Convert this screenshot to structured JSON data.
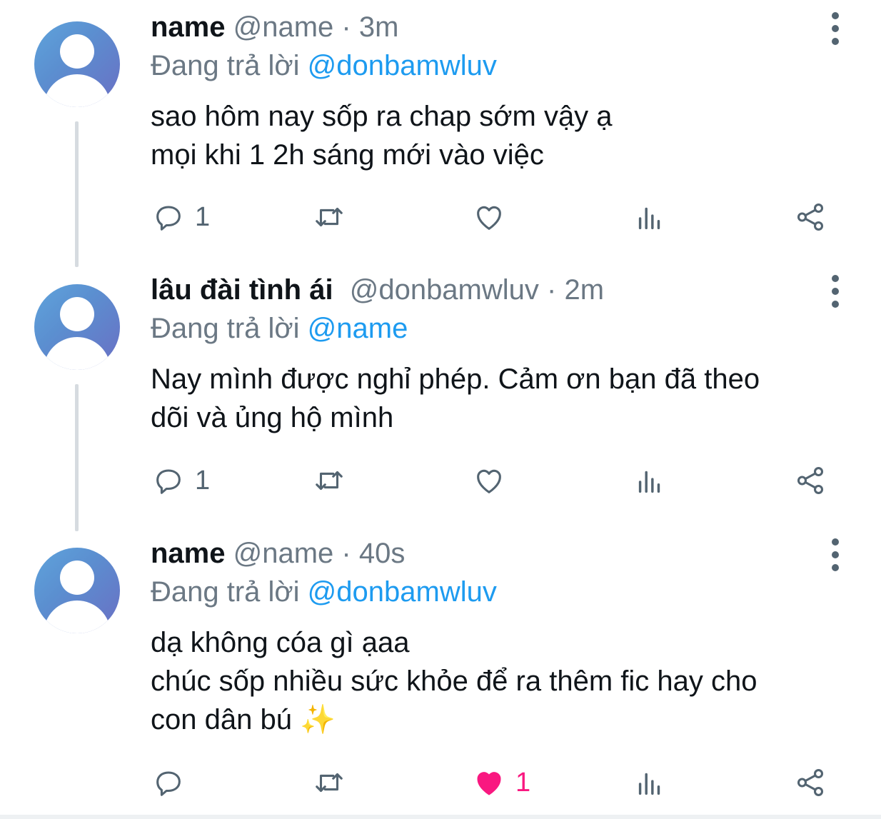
{
  "colors": {
    "link": "#1d9bf0",
    "muted": "#6b7884",
    "text": "#0f1419",
    "like_active": "#f91880"
  },
  "tweets": [
    {
      "display_name": "name",
      "handle": "@name",
      "separator": "·",
      "time": "3m",
      "reply_prefix": "Đang trả lời",
      "reply_to": "@donbamwluv",
      "text": "sao hôm nay sốp ra chap sớm vậy ạ\nmọi khi 1 2h sáng mới vào việc",
      "reply_count": "1",
      "like_count": "",
      "liked": false
    },
    {
      "display_name": "lâu đài tình ái",
      "handle": "@donbamwluv",
      "separator": "·",
      "time": "2m",
      "reply_prefix": "Đang trả lời",
      "reply_to": "@name",
      "text": "Nay mình được nghỉ phép. Cảm ơn bạn đã theo\ndõi và ủng hộ mình",
      "reply_count": "1",
      "like_count": "",
      "liked": false
    },
    {
      "display_name": "name",
      "handle": "@name",
      "separator": "·",
      "time": "40s",
      "reply_prefix": "Đang trả lời",
      "reply_to": "@donbamwluv",
      "text": "dạ không cóa gì ạaa\nchúc sốp nhiều sức khỏe để ra thêm fic hay cho\ncon dân bú ✨",
      "reply_count": "",
      "like_count": "1",
      "liked": true
    }
  ],
  "icons": {
    "reply": "reply-icon",
    "retweet": "retweet-icon",
    "like": "heart-icon",
    "views": "views-icon",
    "share": "share-icon",
    "more": "more-vertical-icon",
    "avatar": "default-avatar-icon"
  }
}
